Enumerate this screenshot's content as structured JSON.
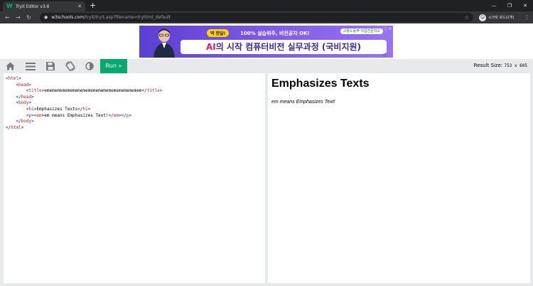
{
  "browser": {
    "tab_title": "Tryit Editor v3.6",
    "tab_close": "✕",
    "new_tab": "+",
    "url_host": "w3schools.com",
    "url_path": "/tryit/tryit.asp?filename=tryhtml_default",
    "profile_initial": "☺",
    "profile_label": "시크릿 모드(2개)"
  },
  "ad": {
    "tag": "딱 한달!",
    "top_text": "100% 실습위주, 비전공자 OK!",
    "brand": "고용노동부 직업전문학교",
    "x": "ⓘ ✕",
    "headline_ai": "AI",
    "headline_rest": "의 시작 컴퓨터비전 실무과정 (국비지원)"
  },
  "toolbar": {
    "run_label": "Run »",
    "result_size_label": "Result Size:",
    "result_size_value": "753 x 605"
  },
  "code": {
    "title_text": "ememememememememememememememememememem",
    "h1_text": "Emphasizes Texts",
    "p_text": "em means Emphasizes Text!"
  },
  "result": {
    "h1": "Emphasizes Texts",
    "p": "em means Emphasizes Text!"
  },
  "colors": {
    "run_green": "#04aa6d",
    "tag_color": "#a52a2a",
    "angle_color": "#0000cd"
  }
}
